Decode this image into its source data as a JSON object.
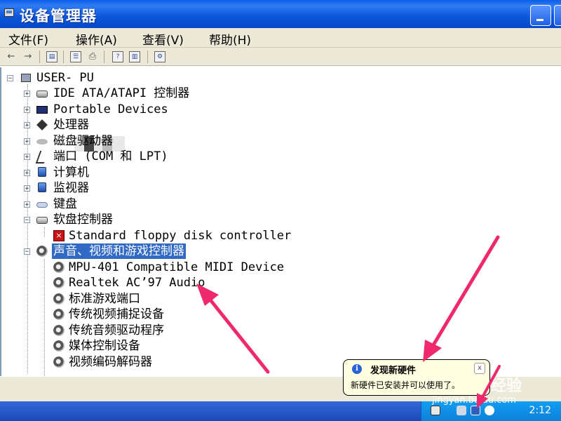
{
  "window": {
    "title": "设备管理器"
  },
  "menu": [
    {
      "label": "文件(F)"
    },
    {
      "label": "操作(A)"
    },
    {
      "label": "查看(V)"
    },
    {
      "label": "帮助(H)"
    }
  ],
  "tree": {
    "root": "USER-          PU",
    "items": [
      {
        "label": "IDE ATA/ATAPI 控制器",
        "icon": "ide-controller-icon",
        "expanded": false
      },
      {
        "label": "Portable Devices",
        "icon": "portable-device-icon",
        "expanded": false
      },
      {
        "label": "处理器",
        "icon": "processor-icon",
        "expanded": false
      },
      {
        "label": "磁盘驱动器",
        "icon": "disk-drive-icon",
        "expanded": false
      },
      {
        "label": "端口 (COM 和 LPT)",
        "icon": "port-icon",
        "expanded": false
      },
      {
        "label": "计算机",
        "icon": "computer-icon",
        "expanded": false
      },
      {
        "label": "监视器",
        "icon": "monitor-icon",
        "expanded": false
      },
      {
        "label": "键盘",
        "icon": "keyboard-icon",
        "expanded": false
      },
      {
        "label": "软盘控制器",
        "icon": "floppy-controller-icon",
        "expanded": true
      },
      {
        "label": "Standard floppy disk controller",
        "icon": "floppy-error-icon",
        "child": true
      },
      {
        "label": "声音、视频和游戏控制器",
        "icon": "sound-icon",
        "expanded": true,
        "selected": true
      },
      {
        "label": "MPU-401 Compatible MIDI Device",
        "icon": "sound-device-icon",
        "child": true
      },
      {
        "label": "Realtek AC’97 Audio",
        "icon": "sound-device-icon",
        "child": true
      },
      {
        "label": "标准游戏端口",
        "icon": "sound-device-icon",
        "child": true
      },
      {
        "label": "传统视频捕捉设备",
        "icon": "sound-device-icon",
        "child": true
      },
      {
        "label": "传统音频驱动程序",
        "icon": "sound-device-icon",
        "child": true
      },
      {
        "label": "媒体控制设备",
        "icon": "sound-device-icon",
        "child": true
      },
      {
        "label": "视频编码解码器",
        "icon": "sound-device-icon",
        "child": true
      }
    ]
  },
  "balloon": {
    "title": "发现新硬件",
    "message": "新硬件已安装并可以使用了。",
    "close": "x"
  },
  "taskbar": {
    "clock": "2:12"
  },
  "watermark": {
    "text": "经验",
    "url": "jingyan.baidu.com"
  },
  "colors": {
    "titlebar": "#0b56dc",
    "selection": "#316ac5",
    "arrow": "#f0286e",
    "balloon_bg": "#ffffe1"
  }
}
